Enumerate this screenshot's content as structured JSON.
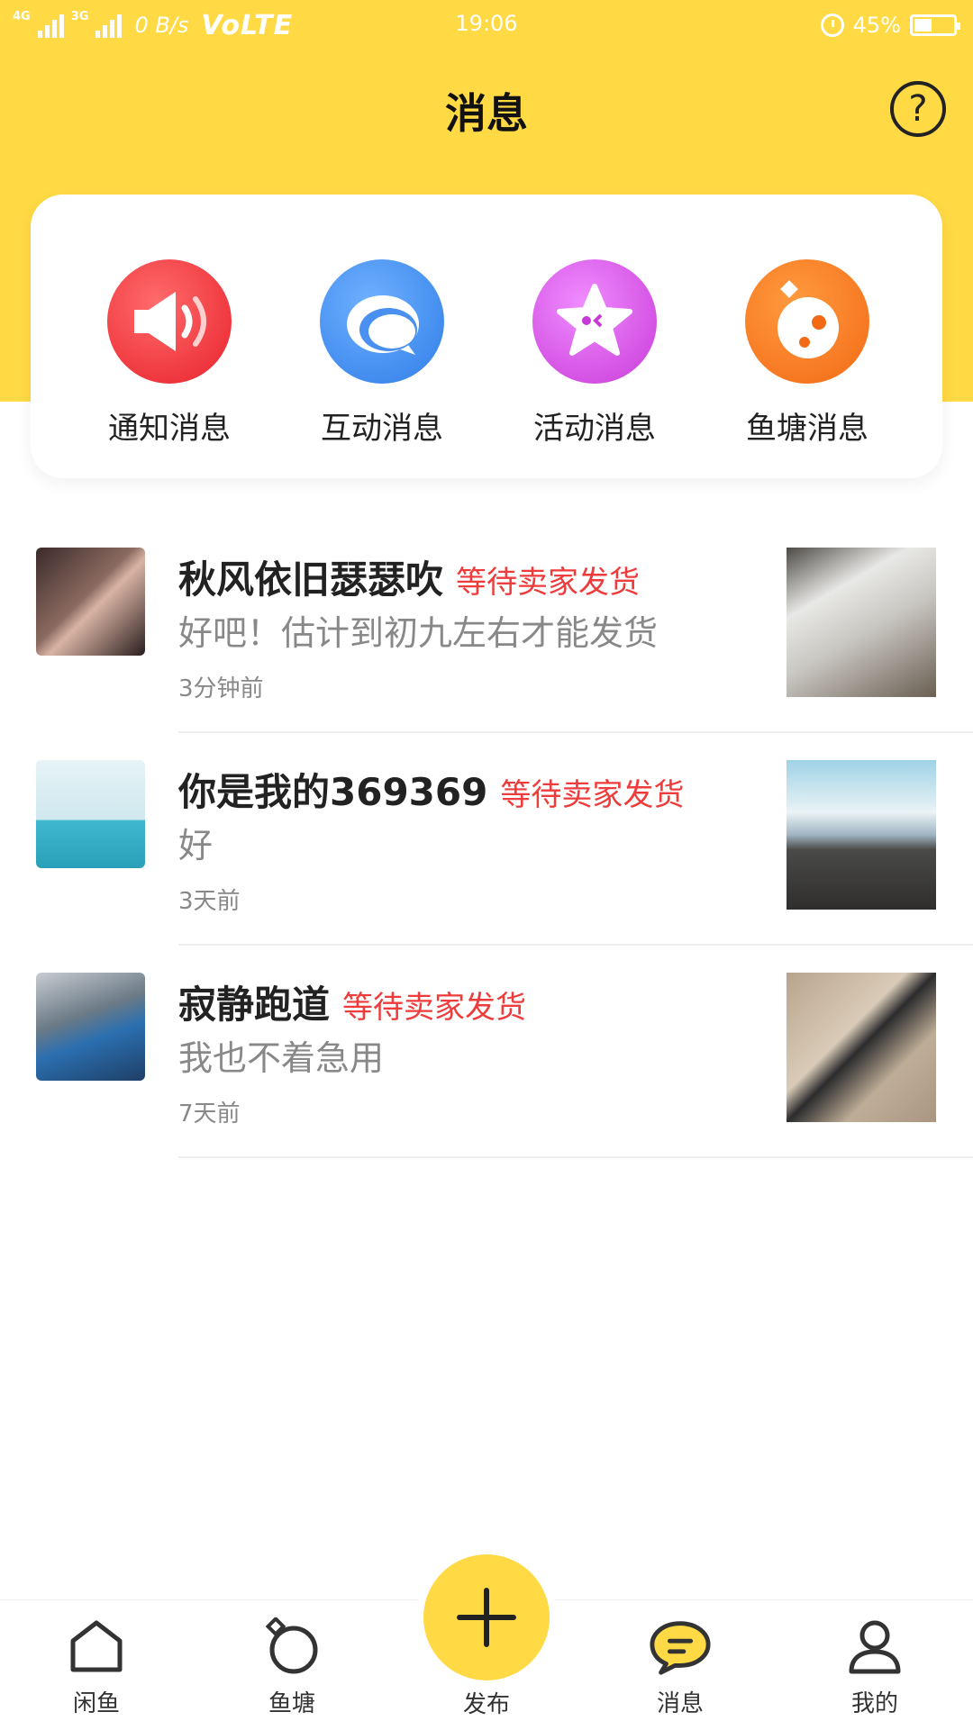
{
  "status_bar": {
    "network_a": "4G",
    "network_b": "3G",
    "speed": "0 B/s",
    "volte": "VoLTE",
    "time": "19:06",
    "battery": "45%",
    "battery_level": 0.45
  },
  "header": {
    "title": "消息",
    "help_symbol": "?"
  },
  "categories": [
    {
      "label": "通知消息",
      "icon": "megaphone-icon",
      "color": "#e8222c"
    },
    {
      "label": "互动消息",
      "icon": "chat-bubbles-icon",
      "color": "#2f7de8"
    },
    {
      "label": "活动消息",
      "icon": "star-icon",
      "color": "#c83ad8"
    },
    {
      "label": "鱼塘消息",
      "icon": "fish-pond-icon",
      "color": "#f36a16"
    }
  ],
  "messages": [
    {
      "name": "秋风依旧瑟瑟吹",
      "status": "等待卖家发货",
      "text": "好吧！估计到初九左右才能发货",
      "time": "3分钟前"
    },
    {
      "name": "你是我的369369",
      "status": "等待卖家发货",
      "text": "好",
      "time": "3天前"
    },
    {
      "name": "寂静跑道",
      "status": "等待卖家发货",
      "text": "我也不着急用",
      "time": "7天前"
    }
  ],
  "tabs": [
    {
      "label": "闲鱼",
      "icon": "home-icon"
    },
    {
      "label": "鱼塘",
      "icon": "pond-icon"
    },
    {
      "label": "发布",
      "icon": "plus-icon"
    },
    {
      "label": "消息",
      "icon": "message-icon"
    },
    {
      "label": "我的",
      "icon": "user-icon"
    }
  ],
  "colors": {
    "accent": "#FFDA44",
    "status_red": "#ee3b3b"
  }
}
